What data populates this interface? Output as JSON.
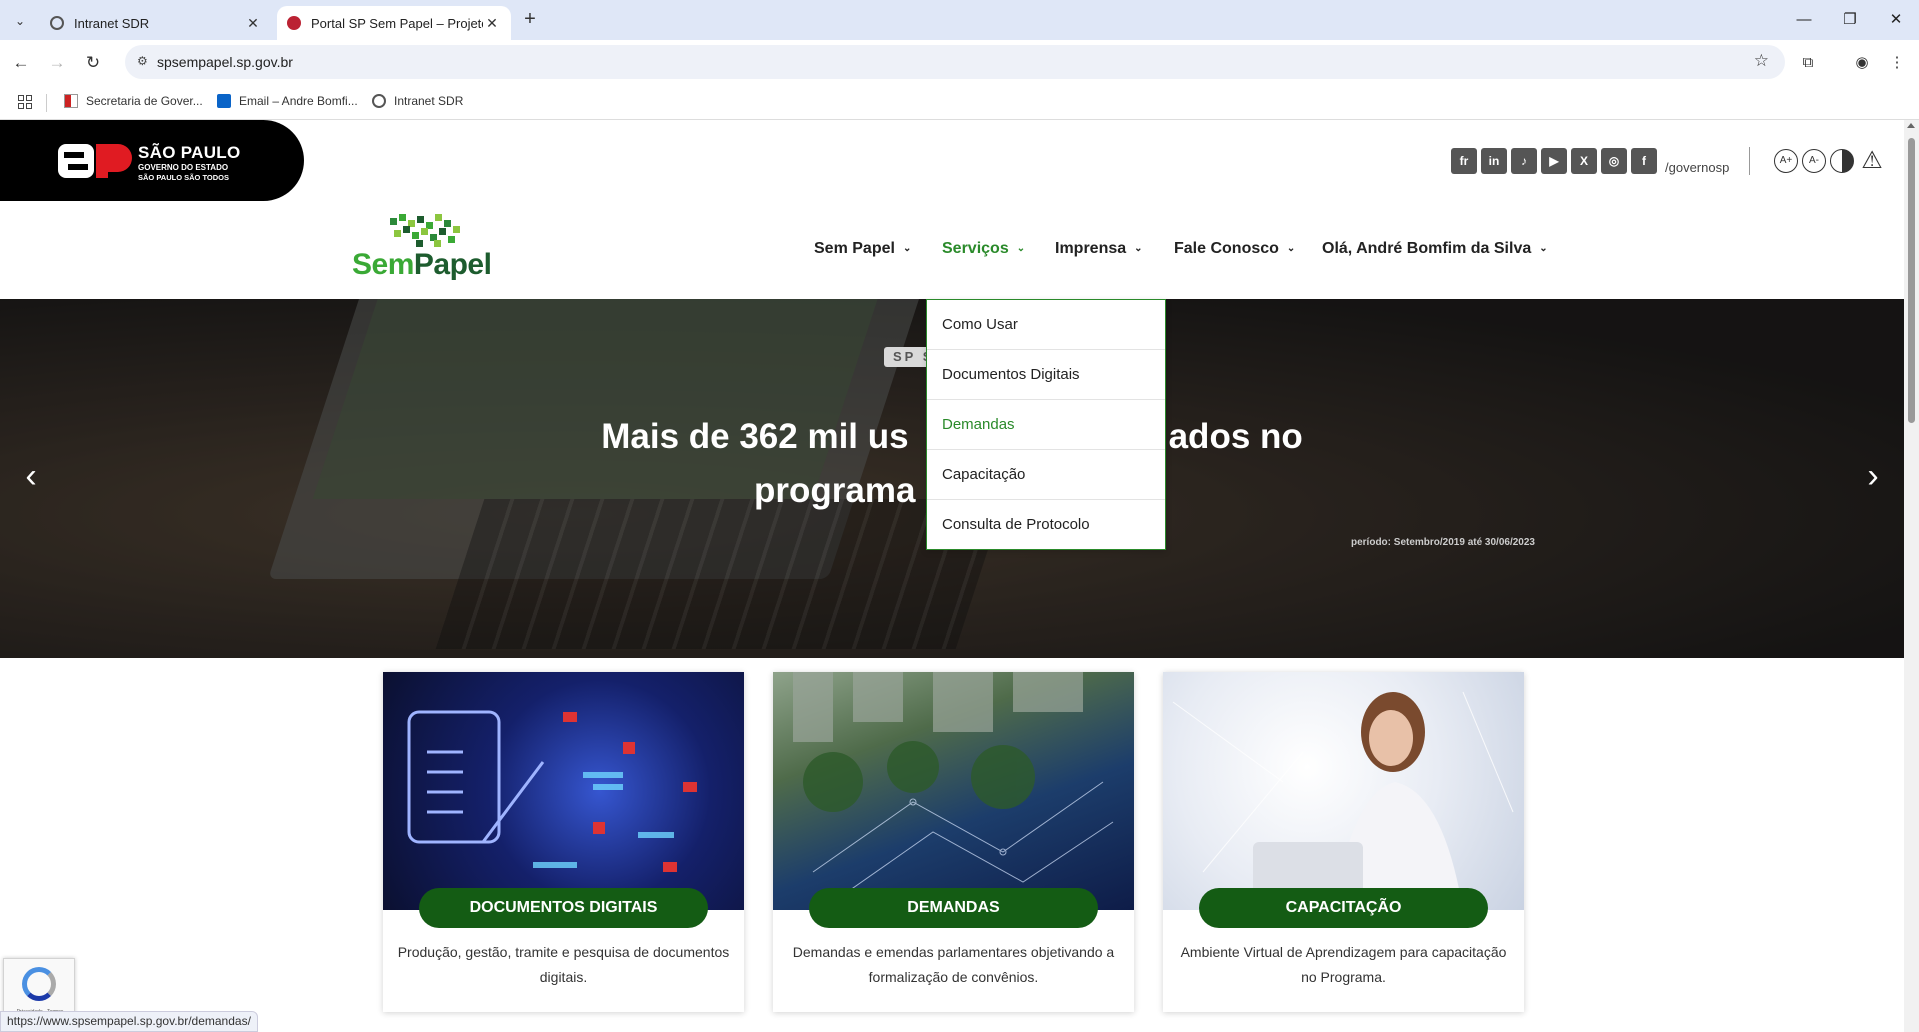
{
  "browser": {
    "tabs": [
      {
        "title": "Intranet SDR",
        "active": false
      },
      {
        "title": "Portal SP Sem Papel – Projeto S",
        "active": true
      }
    ],
    "url": "spsempapel.sp.gov.br",
    "bookmarks": [
      {
        "label": "Secretaria de Gover...",
        "icon": "sp-flag-icon"
      },
      {
        "label": "Email – Andre Bomfi...",
        "icon": "outlook-icon"
      },
      {
        "label": "Intranet SDR",
        "icon": "globe-icon"
      }
    ],
    "status_url": "https://www.spsempapel.sp.gov.br/demandas/"
  },
  "header": {
    "sp_logo": {
      "line1": "SÃO PAULO",
      "line2": "GOVERNO DO ESTADO",
      "line3": "SÃO PAULO SÃO TODOS",
      "mark": "SP"
    },
    "social": [
      {
        "icon": "flickr-icon",
        "glyph": "fr"
      },
      {
        "icon": "linkedin-icon",
        "glyph": "in"
      },
      {
        "icon": "tiktok-icon",
        "glyph": "♪"
      },
      {
        "icon": "youtube-icon",
        "glyph": "▶"
      },
      {
        "icon": "x-icon",
        "glyph": "X"
      },
      {
        "icon": "instagram-icon",
        "glyph": "◎"
      },
      {
        "icon": "facebook-icon",
        "glyph": "f"
      }
    ],
    "handle": "/governosp",
    "accessibility": [
      {
        "icon": "font-increase-icon",
        "glyph": "A+"
      },
      {
        "icon": "font-decrease-icon",
        "glyph": "A-"
      },
      {
        "icon": "contrast-icon",
        "glyph": ""
      },
      {
        "icon": "alert-icon",
        "glyph": "⚠"
      }
    ]
  },
  "logo": {
    "part1": "Sem",
    "part2": "Papel"
  },
  "nav": {
    "items": [
      {
        "label": "Sem Papel"
      },
      {
        "label": "Serviços"
      },
      {
        "label": "Imprensa"
      },
      {
        "label": "Fale Conosco"
      },
      {
        "label": "Olá, André Bomfim da Silva"
      }
    ],
    "dropdown": [
      {
        "label": "Como Usar"
      },
      {
        "label": "Documentos Digitais"
      },
      {
        "label": "Demandas"
      },
      {
        "label": "Capacitação"
      },
      {
        "label": "Consulta de Protocolo"
      }
    ]
  },
  "hero": {
    "tag": "SP S",
    "title_line1": "Mais de 362 mil us",
    "title_line1_end": "ados no",
    "title_line2": "programa S",
    "period": "período: Setembro/2019 até 30/06/2023"
  },
  "cards": [
    {
      "title": "DOCUMENTOS DIGITAIS",
      "desc": "Produção, gestão, tramite e pesquisa de documentos digitais."
    },
    {
      "title": "DEMANDAS",
      "desc": "Demandas e emendas parlamentares objetivando a formalização de convênios."
    },
    {
      "title": "CAPACITAÇÃO",
      "desc": "Ambiente Virtual de Aprendizagem para capacitação no Programa."
    }
  ],
  "recaptcha": {
    "text": "Privacidade - Termos"
  },
  "colors": {
    "brand_green": "#145c14",
    "accent_green": "#2a8a2a",
    "logo_light_green": "#3aa935"
  }
}
